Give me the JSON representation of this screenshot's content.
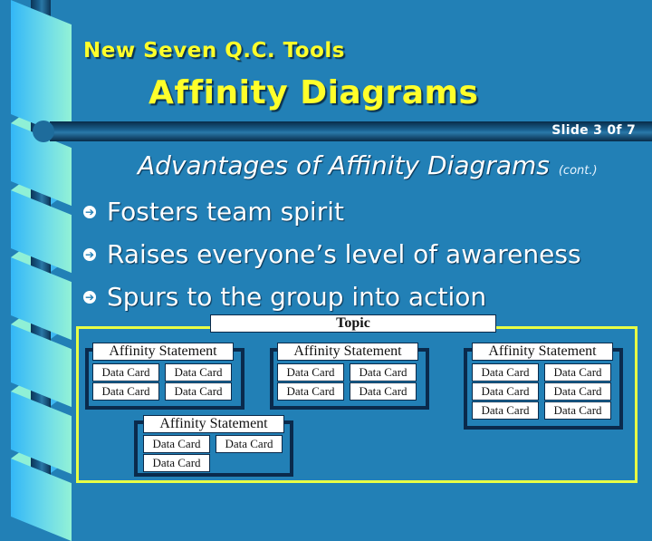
{
  "header": {
    "title": "New Seven Q.C. Tools",
    "subtitle": "Affinity Diagrams",
    "slide_indicator": "Slide 3 0f 7"
  },
  "section": {
    "heading": "Advantages of Affinity Diagrams",
    "heading_note": "(cont.)"
  },
  "bullets": [
    {
      "icon": "arrow-circle-right-icon",
      "text": "Fosters team spirit"
    },
    {
      "icon": "arrow-circle-right-icon",
      "text": "Raises everyone’s level of awareness"
    },
    {
      "icon": "arrow-circle-right-icon",
      "text": "Spurs to the group into action"
    }
  ],
  "diagram": {
    "topic": "Topic",
    "groups": [
      {
        "statement": "Affinity Statement",
        "cards": [
          "Data Card",
          "Data Card",
          "Data Card",
          "Data Card"
        ]
      },
      {
        "statement": "Affinity Statement",
        "cards": [
          "Data Card",
          "Data Card",
          "Data Card",
          "Data Card"
        ]
      },
      {
        "statement": "Affinity Statement",
        "cards": [
          "Data Card",
          "Data Card",
          "Data Card",
          "Data Card",
          "Data Card",
          "Data Card"
        ]
      },
      {
        "statement": "Affinity Statement",
        "cards": [
          "Data Card",
          "Data Card",
          "Data Card"
        ]
      }
    ]
  },
  "colors": {
    "background": "#2280b6",
    "title": "#ffff2a",
    "frame": "#e8ff44",
    "group_border": "#0a2a4c"
  }
}
